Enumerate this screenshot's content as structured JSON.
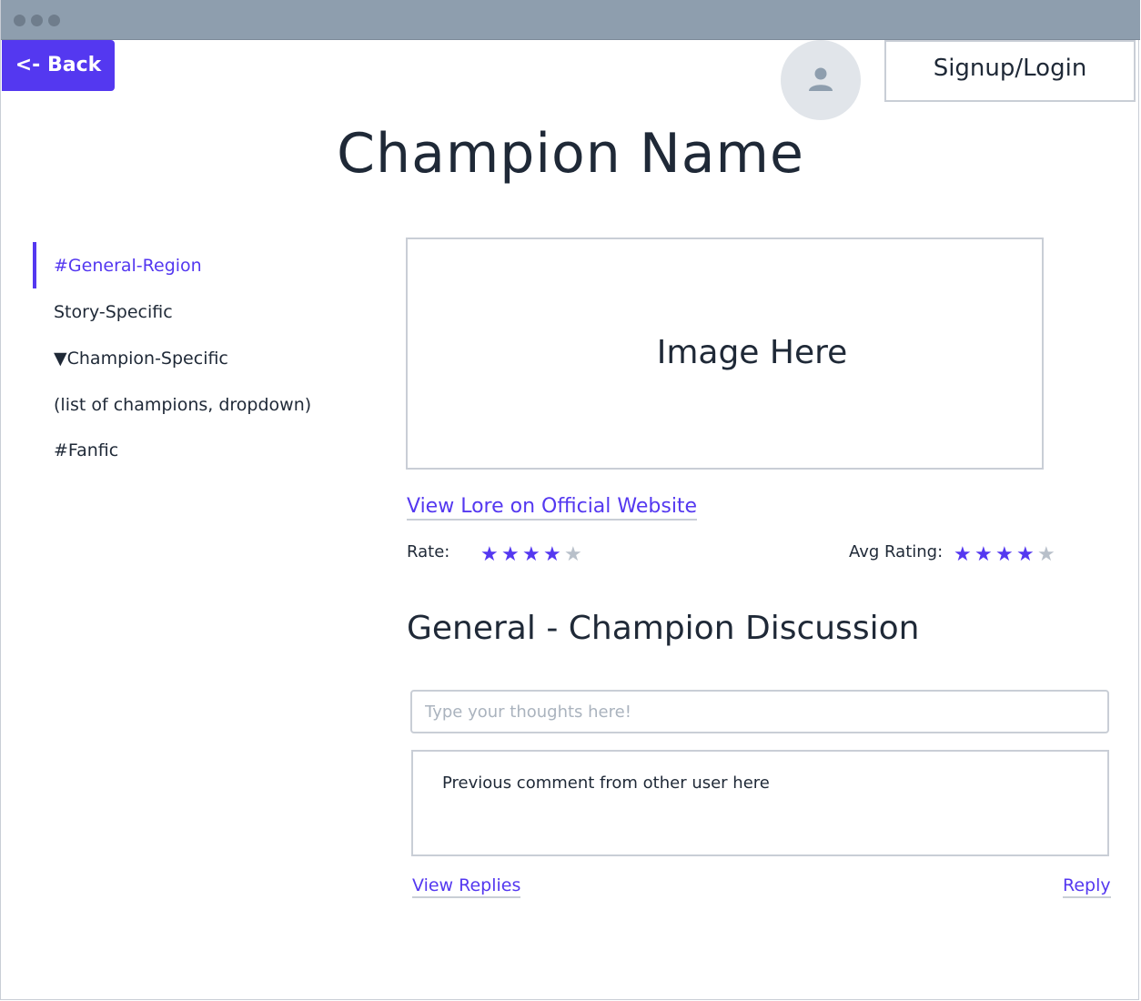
{
  "header": {
    "back_label": "<- Back",
    "signup_label": "Signup/Login",
    "avatar_icon": "user-icon"
  },
  "page": {
    "title": "Champion Name"
  },
  "sidebar": {
    "items": [
      {
        "label": "#General-Region",
        "active": true
      },
      {
        "label": "Story-Specific",
        "active": false
      },
      {
        "label": "▼Champion-Specific",
        "active": false
      },
      {
        "label": "(list of champions, dropdown)",
        "active": false
      },
      {
        "label": "#Fanfic",
        "active": false
      }
    ]
  },
  "main": {
    "image_placeholder": "Image Here",
    "lore_link": "View Lore on Official Website",
    "rate_label": "Rate:",
    "rate_value": 4,
    "avg_label": "Avg Rating:",
    "avg_value": 4,
    "star_max": 5,
    "section_heading": "General - Champion Discussion",
    "comment_placeholder": "Type your thoughts here!",
    "comment_value": "",
    "previous_comment": "Previous comment from other user here",
    "view_replies": "View Replies",
    "reply": "Reply"
  },
  "colors": {
    "accent": "#5438f0",
    "titlebar": "#8e9eae",
    "border": "#c9ced6",
    "star_off": "#b8c0ca"
  }
}
